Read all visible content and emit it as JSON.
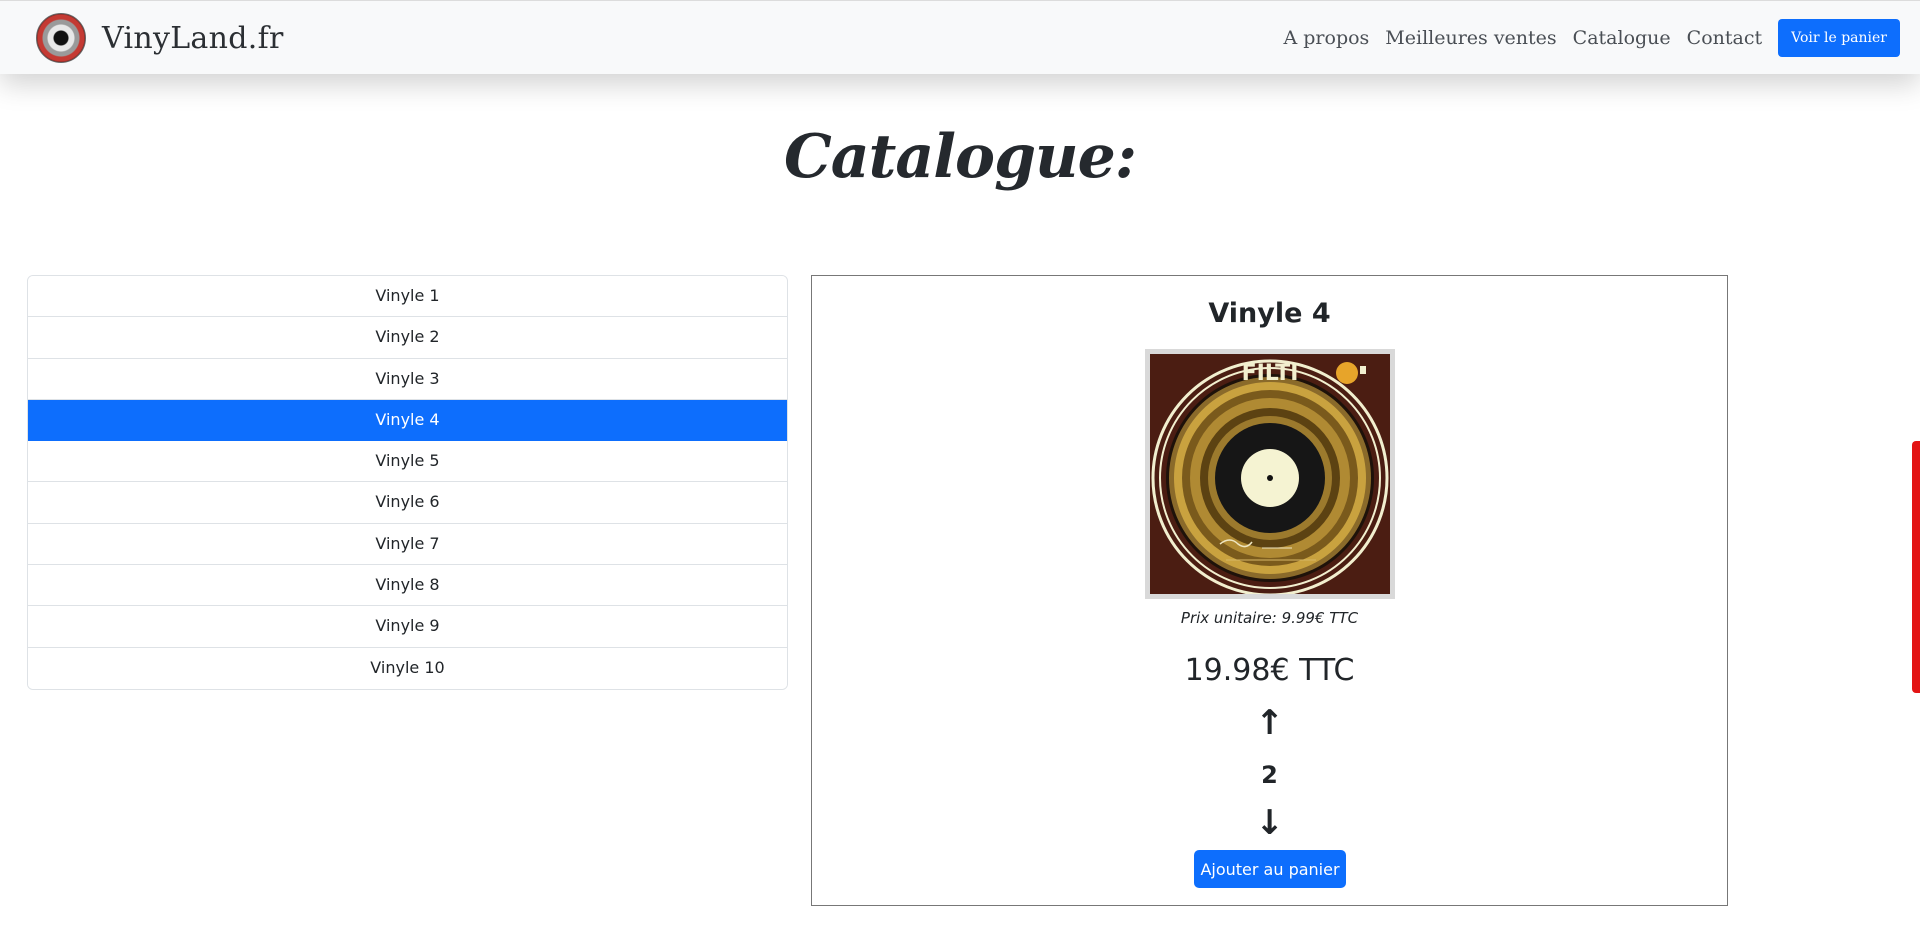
{
  "navbar": {
    "brand": "VinyLand.fr",
    "links": [
      "A propos",
      "Meilleures ventes",
      "Catalogue",
      "Contact"
    ],
    "cart_button": "Voir le panier"
  },
  "page": {
    "title": "Catalogue:"
  },
  "catalog": {
    "items": [
      "Vinyle 1",
      "Vinyle 2",
      "Vinyle 3",
      "Vinyle 4",
      "Vinyle 5",
      "Vinyle 6",
      "Vinyle 7",
      "Vinyle 8",
      "Vinyle 9",
      "Vinyle 10"
    ],
    "selected": "Vinyle 4"
  },
  "product": {
    "name": "Vinyle 4",
    "cover_label": "FILTI",
    "unit_price": "Prix unitaire: 9.99€ TTC",
    "total_price": "19.98€ TTC",
    "quantity": "2",
    "increment_glyph": "↑",
    "decrement_glyph": "↓",
    "add_button": "Ajouter au panier"
  },
  "colors": {
    "accent": "#0d6efd",
    "scrollbar": "#e31414"
  }
}
